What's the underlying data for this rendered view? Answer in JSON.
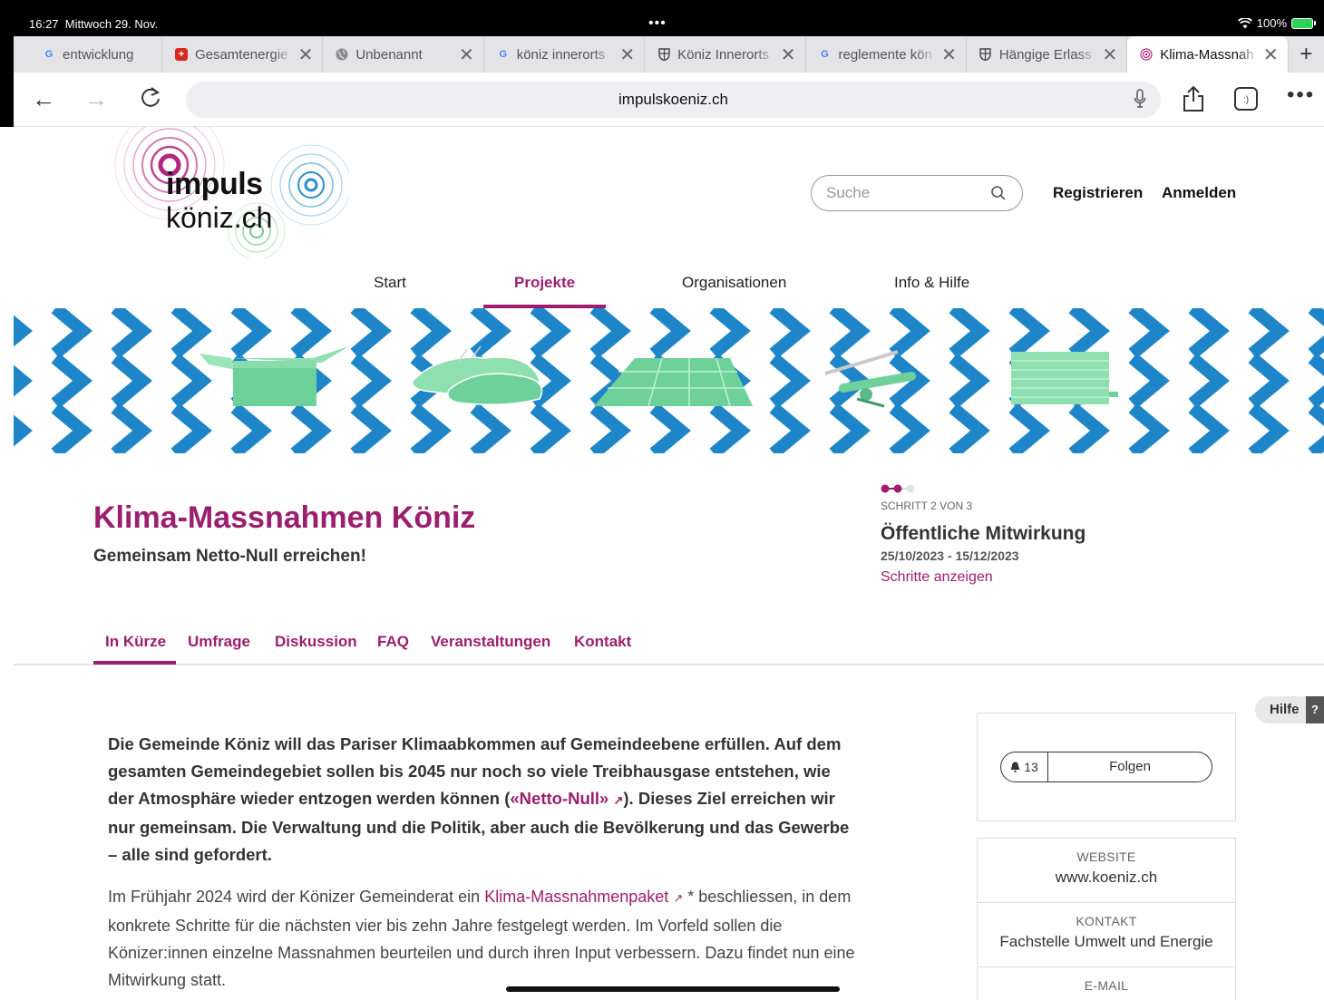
{
  "status": {
    "time": "16:27",
    "date": "Mittwoch 29. Nov.",
    "dots": "•••",
    "battery": "100%"
  },
  "tabs": [
    {
      "title": "entwicklung",
      "favicon": "google-icon",
      "active": false
    },
    {
      "title": "Gesamtenergie",
      "favicon": "swiss-flag-icon",
      "active": false
    },
    {
      "title": "Unbenannt",
      "favicon": "globe-icon",
      "active": false
    },
    {
      "title": "köniz innerorts",
      "favicon": "google-icon",
      "active": false
    },
    {
      "title": "Köniz Innerorts",
      "favicon": "koeniz-shield-icon",
      "active": false
    },
    {
      "title": "reglemente kön",
      "favicon": "google-icon",
      "active": false
    },
    {
      "title": "Hängige Erlass",
      "favicon": "koeniz-shield-icon",
      "active": false
    },
    {
      "title": "Klima-Massnah",
      "favicon": "impuls-icon",
      "active": true
    }
  ],
  "toolbar": {
    "url": "impulskoeniz.ch",
    "new_tab": "+",
    "reader_label": ":)"
  },
  "site": {
    "logo_line1": "impuls",
    "logo_line2": "köniz.ch",
    "search_placeholder": "Suche",
    "register": "Registrieren",
    "login": "Anmelden",
    "nav": [
      "Start",
      "Projekte",
      "Organisationen",
      "Info & Hilfe"
    ],
    "nav_active": "Projekte"
  },
  "project": {
    "title": "Klima-Massnahmen Köniz",
    "subtitle": "Gemeinsam Netto-Null erreichen!",
    "step_label": "SCHRITT 2 VON 3",
    "step_current": 2,
    "step_total": 3,
    "step_title": "Öffentliche Mitwirkung",
    "step_dates": "25/10/2023 - 15/12/2023",
    "step_link": "Schritte anzeigen",
    "tabs": [
      "In Kürze",
      "Umfrage",
      "Diskussion",
      "FAQ",
      "Veranstaltungen",
      "Kontakt"
    ],
    "tab_active": "In Kürze"
  },
  "content": {
    "lead_part1": "Die Gemeinde Köniz will das Pariser Klimaabkommen auf Gemeindeebene erfüllen. Auf dem gesamten Gemeindegebiet sollen bis 2045 nur noch so viele Treibhausgase entstehen, wie der Atmosphäre wieder entzogen werden können (",
    "lead_link": "«Netto-Null»",
    "lead_part2": "). Dieses Ziel erreichen wir nur gemeinsam. Die Verwaltung und die Politik, aber auch die Bevölkerung und das Gewerbe – alle sind gefordert.",
    "para_part1": "Im Frühjahr 2024 wird der Könizer Gemeinderat ein ",
    "para_link": "Klima-Massnahmenpaket",
    "para_part2": " * beschliessen, in dem konkrete Schritte für die nächsten vier bis zehn Jahre festgelegt werden. Im Vorfeld sollen die Könizer:innen einzelne Massnahmen beurteilen und durch ihren Input verbessern. Dazu findet nun eine Mitwirkung statt."
  },
  "sidebar": {
    "help": "Hilfe",
    "help_q": "?",
    "followers": "13",
    "follow": "Folgen",
    "website_label": "WEBSITE",
    "website": "www.koeniz.ch",
    "contact_label": "KONTAKT",
    "contact": "Fachstelle Umwelt und Energie",
    "email_label": "E-MAIL"
  },
  "colors": {
    "accent": "#9b1f6e",
    "banner_blue": "#1e86c8",
    "banner_green": "#6fd19a"
  }
}
